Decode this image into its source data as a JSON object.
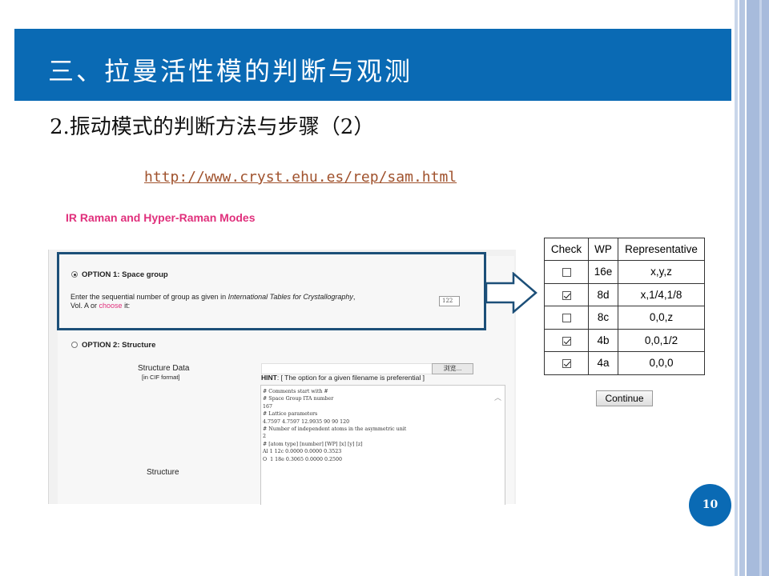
{
  "slide": {
    "title": "三、拉曼活性模的判断与观测",
    "subtitle": "2.振动模式的判断方法与步骤（2）",
    "url": "http://www.cryst.ehu.es/rep/sam.html",
    "page_number": "10",
    "accent_color": "#0a6ab4"
  },
  "form": {
    "heading": "IR Raman and Hyper-Raman Modes",
    "option1": {
      "label": "OPTION 1: Space group",
      "selected": true,
      "desc_prefix": "Enter the sequential number of group as given in ",
      "desc_italic": "International Tables for Crystallography",
      "desc_suffix": ",",
      "desc_line2_prefix": "Vol. A or ",
      "choose_link": "choose",
      "desc_line2_suffix": " it:",
      "value": "122"
    },
    "option2": {
      "label": "OPTION 2: Structure",
      "selected": false,
      "structure_data_label": "Structure Data",
      "cif_label": "[in CIF format]",
      "browse_label": "浏览...",
      "hint_bold": "HINT",
      "hint_text": ": [ The option for a given filename is preferential ]",
      "structure_label": "Structure",
      "code_lines": [
        "# Comments start with #",
        "# Space Group ITA number",
        "167",
        "# Lattice parameters",
        "4.7597 4.7597 12.9935 90 90 120",
        "# Number of independent atoms in the asymmetric unit",
        "2",
        "# [atom type] [number] [WP] [x] [y] [z]",
        "Al 1 12c 0.0000 0.0000 0.3523",
        "O  1 18e 0.3065 0.0000 0.2500"
      ]
    }
  },
  "wp_table": {
    "headers": [
      "Check",
      "WP",
      "Representative"
    ],
    "rows": [
      {
        "checked": false,
        "wp": "16e",
        "rep": "x,y,z"
      },
      {
        "checked": true,
        "wp": "8d",
        "rep": "x,1/4,1/8"
      },
      {
        "checked": false,
        "wp": "8c",
        "rep": "0,0,z"
      },
      {
        "checked": true,
        "wp": "4b",
        "rep": "0,0,1/2"
      },
      {
        "checked": true,
        "wp": "4a",
        "rep": "0,0,0"
      }
    ],
    "continue_label": "Continue"
  }
}
